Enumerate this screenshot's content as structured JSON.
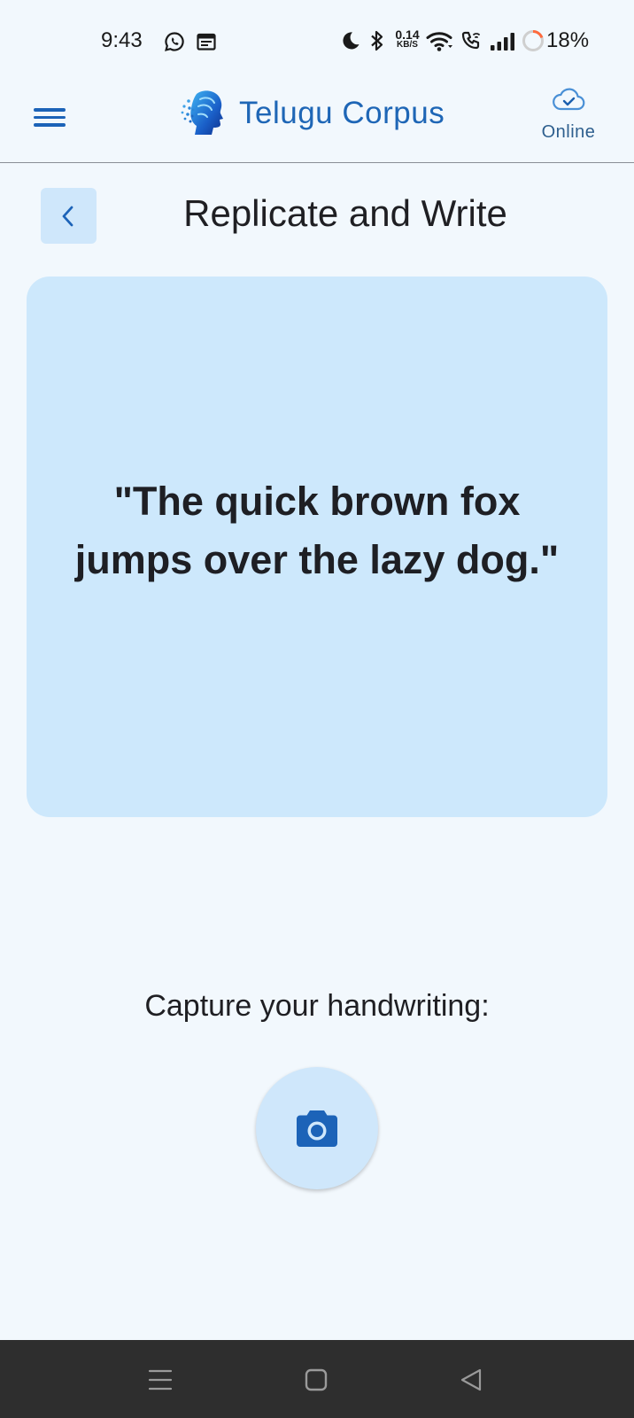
{
  "status_bar": {
    "time": "9:43",
    "net_speed_value": "0.14",
    "net_speed_unit": "KB/S",
    "battery": "18%",
    "icons": [
      "whatsapp-icon",
      "calendar-icon",
      "moon-icon",
      "bluetooth-icon",
      "wifi-icon",
      "wifi-calling-icon",
      "signal-icon",
      "battery-icon"
    ]
  },
  "app_bar": {
    "title": "Telugu Corpus",
    "status": "Online",
    "icons": [
      "menu-icon",
      "app-logo-icon",
      "cloud-check-icon"
    ]
  },
  "page": {
    "title": "Replicate and Write",
    "back_icon": "chevron-left-icon"
  },
  "prompt": {
    "text": "\"The quick brown fox jumps over the lazy dog.\""
  },
  "capture": {
    "label": "Capture your handwriting:",
    "icon": "camera-icon"
  },
  "nav": {
    "icons": [
      "recents-icon",
      "home-icon",
      "back-icon"
    ]
  },
  "colors": {
    "background": "#f2f8fd",
    "primary": "#1e66b6",
    "card": "#cde8fc",
    "button_tint": "#cfe7fb",
    "nav_bar": "#2e2e2e"
  }
}
